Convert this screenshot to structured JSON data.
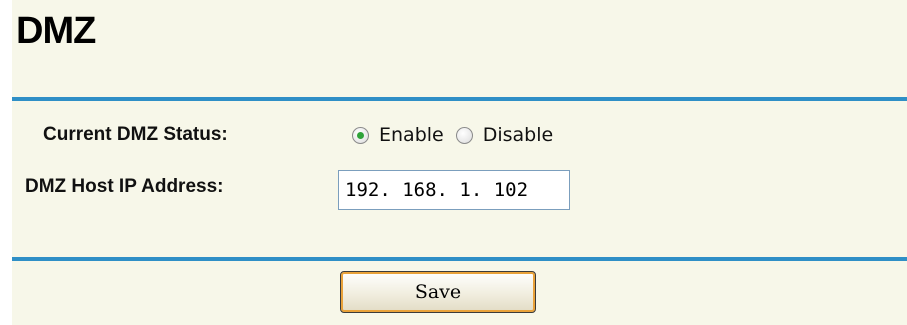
{
  "page": {
    "title": "DMZ"
  },
  "form": {
    "status_label": "Current DMZ Status:",
    "status_options": [
      {
        "label": "Enable",
        "checked": true
      },
      {
        "label": "Disable",
        "checked": false
      }
    ],
    "host_ip_label": "DMZ Host IP Address:",
    "host_ip_value": "192. 168. 1. 102"
  },
  "actions": {
    "save_label": "Save"
  },
  "colors": {
    "panel_background": "#f7f7e9",
    "rule": "#2f8fc6",
    "radio_selected": "#2fa33a",
    "save_button_highlight": "#e9a23a"
  }
}
